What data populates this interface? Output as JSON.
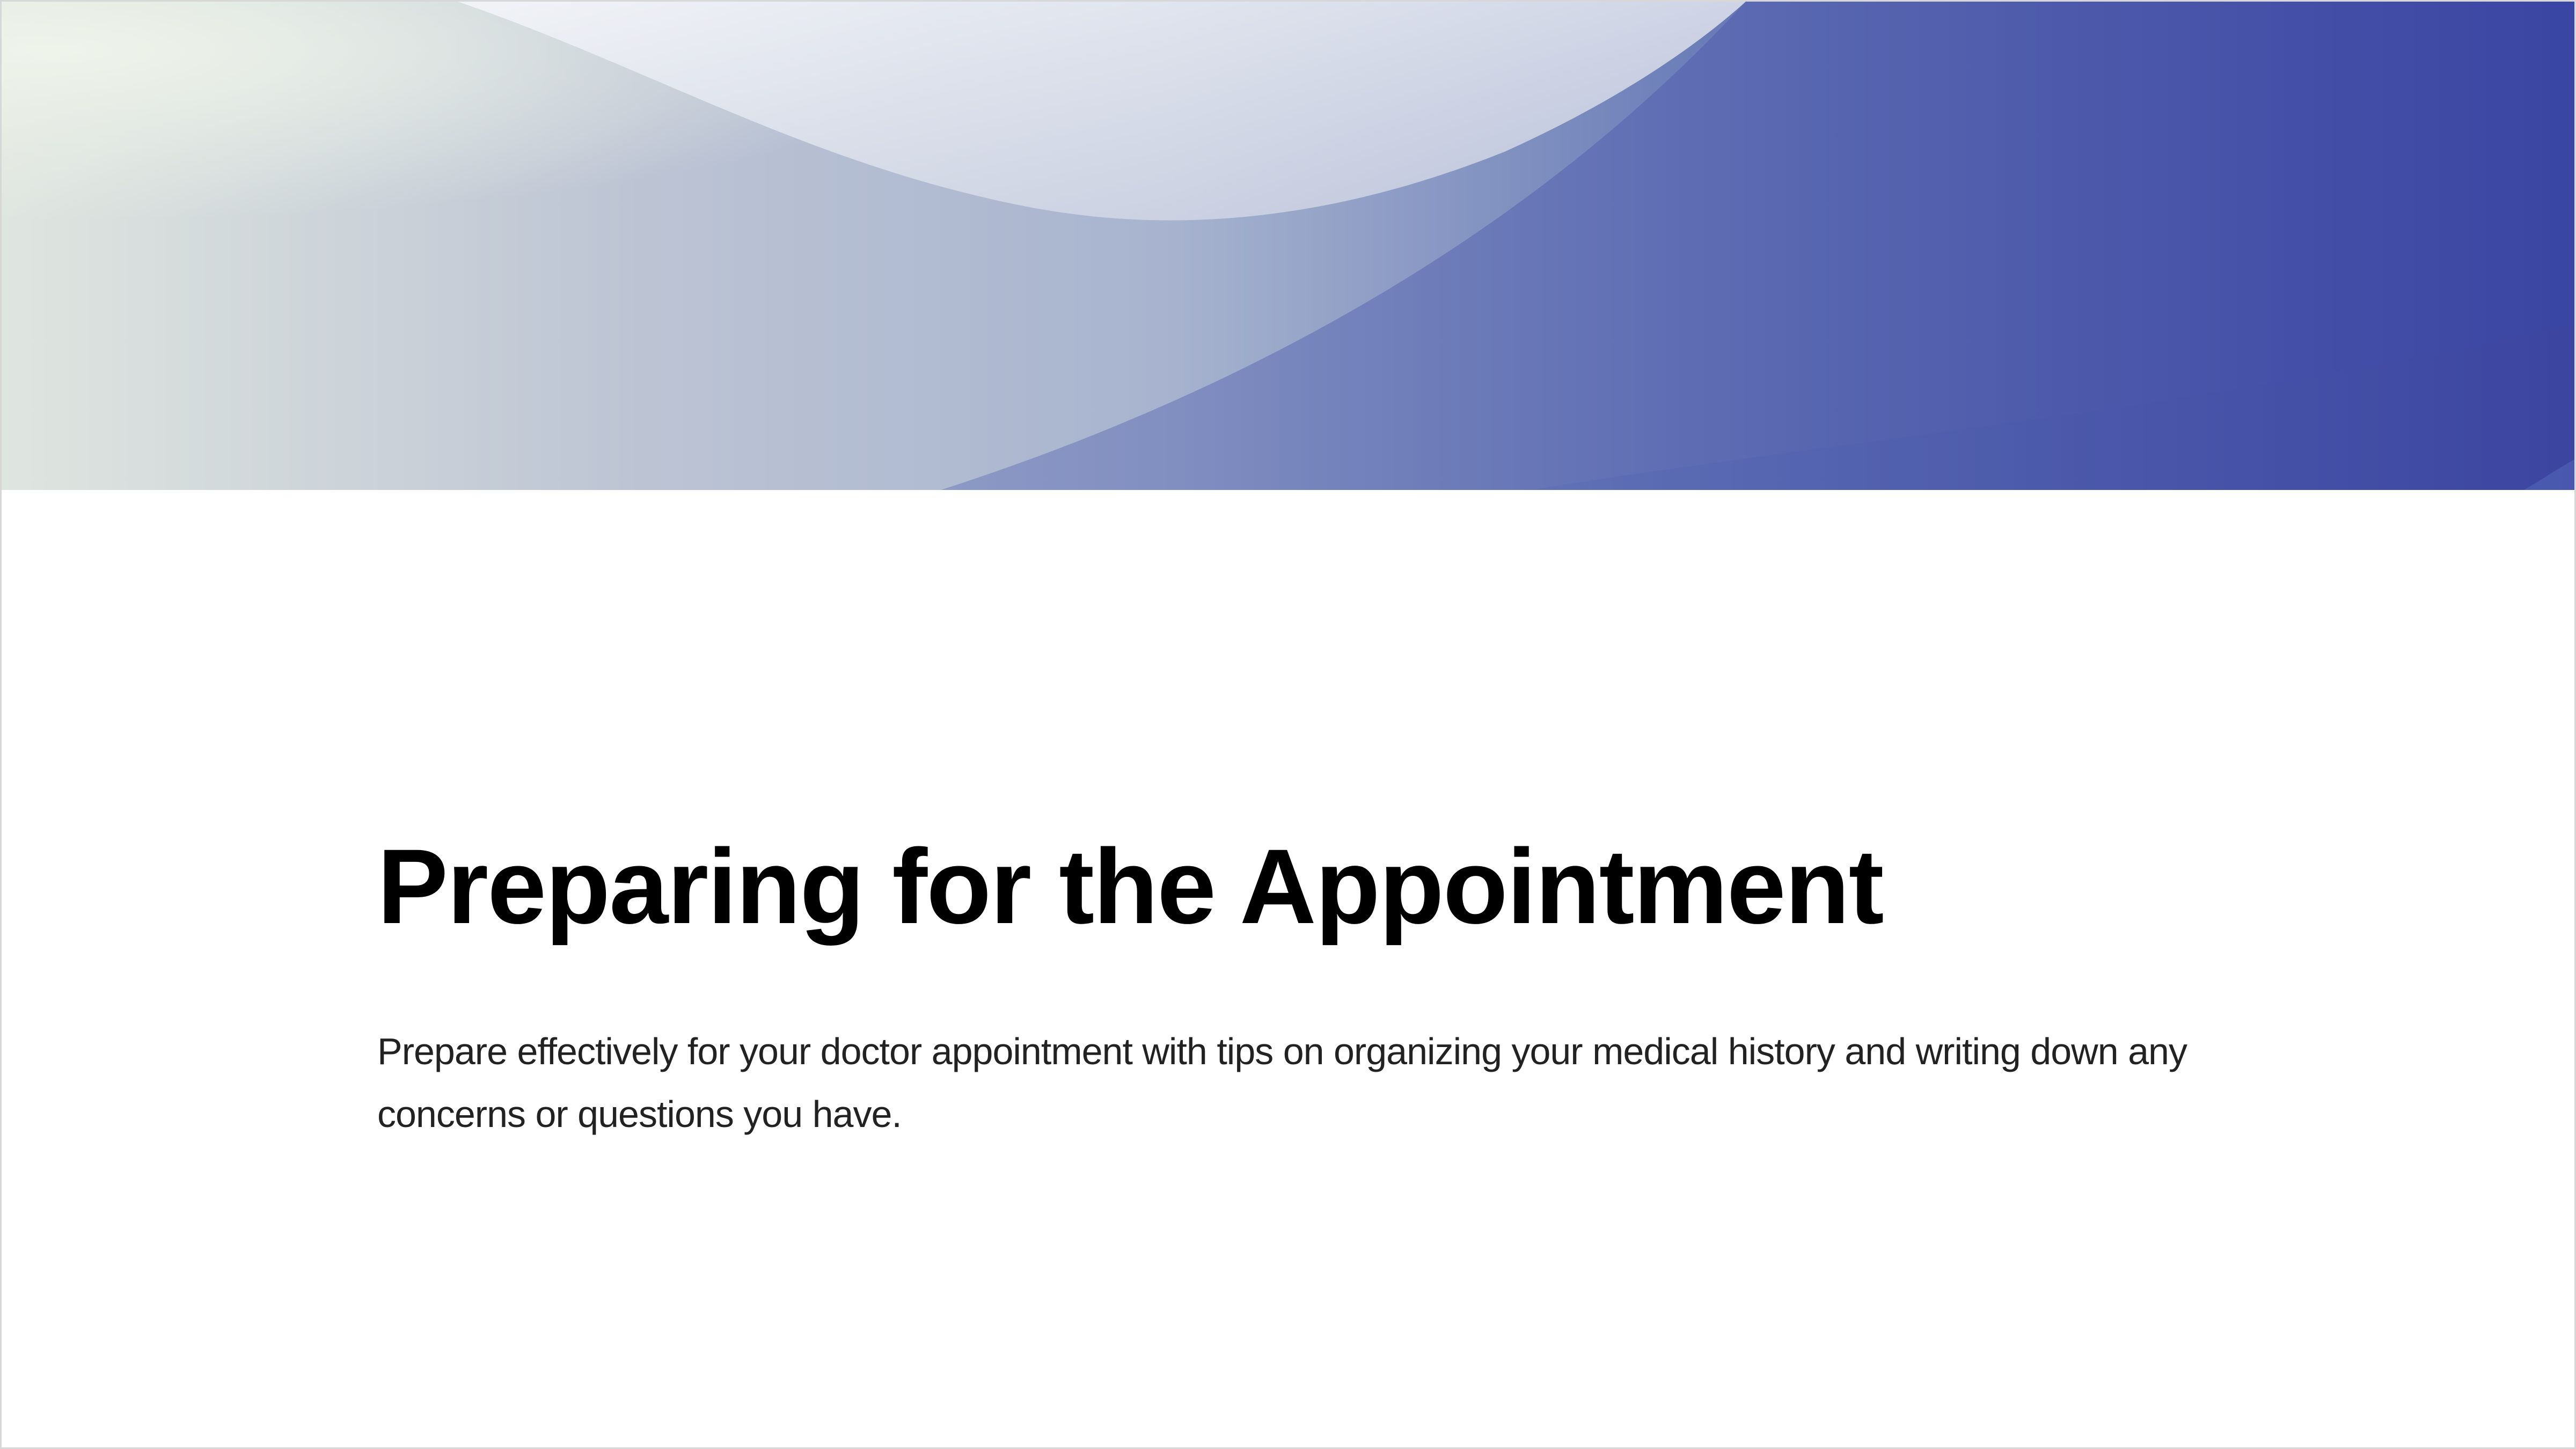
{
  "slide": {
    "title": "Preparing for the Appointment",
    "body": "Prepare effectively for your doctor appointment with tips on organizing your medical history and writing down any concerns or questions you have."
  },
  "colors": {
    "title": "#000000",
    "body": "#222222",
    "banner_light": "#e9eee5",
    "banner_mid": "#a7b4cf",
    "banner_dark": "#33389a"
  }
}
